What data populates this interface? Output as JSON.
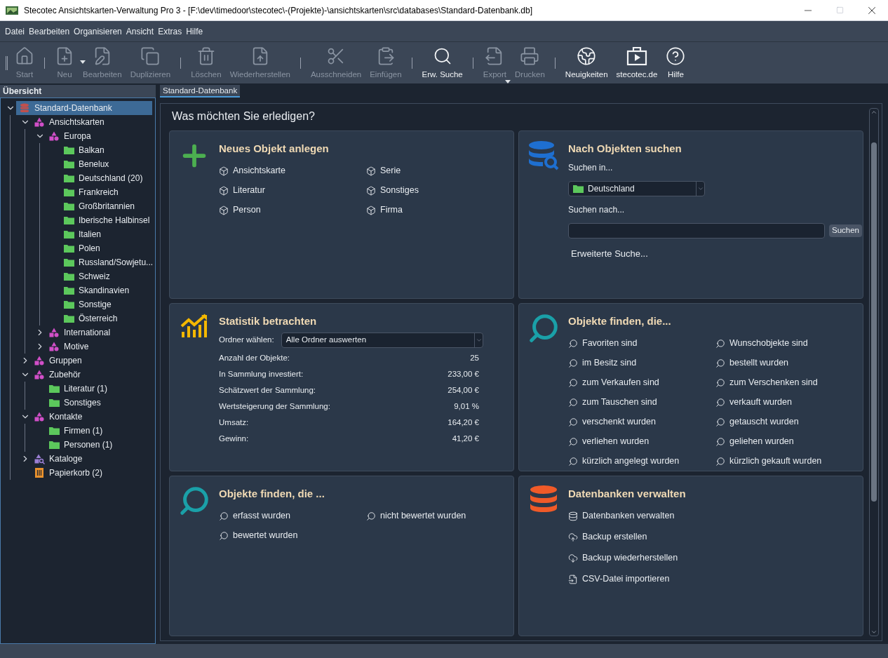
{
  "window": {
    "title": "Stecotec Ansichtskarten-Verwaltung Pro 3 - [F:\\dev\\timedoor\\stecotec\\-(Projekte)-\\ansichtskarten\\src\\databases\\Standard-Datenbank.db]"
  },
  "menu": [
    "Datei",
    "Bearbeiten",
    "Organisieren",
    "Ansicht",
    "Extras",
    "Hilfe"
  ],
  "toolbar": [
    [
      {
        "label": "Start",
        "disabled": true,
        "dropdown": false
      }
    ],
    [
      {
        "label": "Neu",
        "disabled": true,
        "dropdown": true
      },
      {
        "label": "Bearbeiten",
        "disabled": true,
        "dropdown": false
      },
      {
        "label": "Duplizieren",
        "disabled": true,
        "dropdown": false
      }
    ],
    [
      {
        "label": "Löschen",
        "disabled": true,
        "dropdown": false
      },
      {
        "label": "Wiederherstellen",
        "disabled": true,
        "dropdown": false
      }
    ],
    [
      {
        "label": "Ausschneiden",
        "disabled": true,
        "dropdown": false
      },
      {
        "label": "Einfügen",
        "disabled": true,
        "dropdown": false
      }
    ],
    [
      {
        "label": "Erw. Suche",
        "disabled": false,
        "dropdown": false
      }
    ],
    [
      {
        "label": "Export",
        "disabled": true,
        "dropdown": true
      },
      {
        "label": "Drucken",
        "disabled": true,
        "dropdown": false
      }
    ],
    [
      {
        "label": "Neuigkeiten",
        "disabled": false,
        "dropdown": false
      },
      {
        "label": "stecotec.de",
        "disabled": false,
        "dropdown": false
      },
      {
        "label": "Hilfe",
        "disabled": false,
        "dropdown": false
      }
    ]
  ],
  "sidebar": {
    "title": "Übersicht",
    "tree": [
      {
        "kind": "database",
        "label": "Standard-Datenbank",
        "selected": true,
        "expanded": true,
        "children": [
          {
            "kind": "category",
            "label": "Ansichtskarten",
            "selected": false,
            "expanded": true,
            "children": [
              {
                "kind": "category",
                "label": "Europa",
                "selected": false,
                "expanded": true,
                "children": [
                  {
                    "kind": "folder",
                    "label": "Balkan",
                    "selected": false
                  },
                  {
                    "kind": "folder",
                    "label": "Benelux",
                    "selected": false
                  },
                  {
                    "kind": "folder",
                    "label": "Deutschland (20)",
                    "selected": false
                  },
                  {
                    "kind": "folder",
                    "label": "Frankreich",
                    "selected": false
                  },
                  {
                    "kind": "folder",
                    "label": "Großbritannien",
                    "selected": false
                  },
                  {
                    "kind": "folder",
                    "label": "Iberische Halbinsel",
                    "selected": false
                  },
                  {
                    "kind": "folder",
                    "label": "Italien",
                    "selected": false
                  },
                  {
                    "kind": "folder",
                    "label": "Polen",
                    "selected": false
                  },
                  {
                    "kind": "folder",
                    "label": "Russland/Sowjetu...",
                    "selected": false
                  },
                  {
                    "kind": "folder",
                    "label": "Schweiz",
                    "selected": false
                  },
                  {
                    "kind": "folder",
                    "label": "Skandinavien",
                    "selected": false
                  },
                  {
                    "kind": "folder",
                    "label": "Sonstige",
                    "selected": false
                  },
                  {
                    "kind": "folder",
                    "label": "Österreich",
                    "selected": false
                  }
                ]
              },
              {
                "kind": "category",
                "label": "International",
                "selected": false,
                "expanded": false
              },
              {
                "kind": "category",
                "label": "Motive",
                "selected": false,
                "expanded": false
              }
            ]
          },
          {
            "kind": "category",
            "label": "Gruppen",
            "selected": false,
            "expanded": false
          },
          {
            "kind": "category",
            "label": "Zubehör",
            "selected": false,
            "expanded": true,
            "children": [
              {
                "kind": "folder",
                "label": "Literatur (1)",
                "selected": false
              },
              {
                "kind": "folder",
                "label": "Sonstiges",
                "selected": false
              }
            ]
          },
          {
            "kind": "category",
            "label": "Kontakte",
            "selected": false,
            "expanded": true,
            "children": [
              {
                "kind": "folder",
                "label": "Firmen (1)",
                "selected": false
              },
              {
                "kind": "folder",
                "label": "Personen (1)",
                "selected": false
              }
            ]
          },
          {
            "kind": "catalog",
            "label": "Kataloge",
            "selected": false,
            "expanded": false
          },
          {
            "kind": "trash",
            "label": "Papierkorb (2)",
            "selected": false
          }
        ]
      }
    ]
  },
  "tab": {
    "label": "Standard-Datenbank",
    "selected": true
  },
  "heading": "Was möchten Sie erledigen?",
  "cards": [
    {
      "kind": "grid",
      "title": "Neues Objekt anlegen",
      "links": [
        "Ansichtskarte",
        "Serie",
        "Literatur",
        "Sonstiges",
        "Person",
        "Firma"
      ]
    },
    {
      "kind": "search",
      "title": "Nach Objekten suchen",
      "scope_label": "Suchen in...",
      "scope": "Deutschland",
      "query_label": "Suchen nach...",
      "button": "Suchen",
      "link": "Erweiterte Suche..."
    },
    {
      "kind": "stats",
      "title": "Statistik betrachten",
      "folder_label": "Ordner wählen:",
      "folder": "Alle Ordner auswerten",
      "rows": [
        {
          "label": "Anzahl der Objekte:",
          "value": "25"
        },
        {
          "label": "In Sammlung investiert:",
          "value": "233,00 €"
        },
        {
          "label": "Schätzwert der Sammlung:",
          "value": "254,00 €"
        },
        {
          "label": "Wertsteigerung der Sammlung:",
          "value": "9,01 %"
        },
        {
          "label": "Umsatz:",
          "value": "164,20 €"
        },
        {
          "label": "Gewinn:",
          "value": "41,20 €"
        }
      ]
    },
    {
      "kind": "grid",
      "title": "Objekte finden, die...",
      "links": [
        "Favoriten sind",
        "Wunschobjekte sind",
        "im Besitz sind",
        "bestellt wurden",
        "zum Verkaufen sind",
        "zum Verschenken sind",
        "zum Tauschen sind",
        "verkauft wurden",
        "verschenkt wurden",
        "getauscht wurden",
        "verliehen wurden",
        "geliehen wurden",
        "kürzlich angelegt wurden",
        "kürzlich gekauft wurden"
      ]
    },
    {
      "kind": "grid",
      "title": "Objekte finden, die ...",
      "links": [
        "erfasst wurden",
        "nicht bewertet wurden",
        "bewertet wurden"
      ]
    },
    {
      "kind": "list",
      "title": "Datenbanken verwalten",
      "links": [
        "Datenbanken verwalten",
        "Backup erstellen",
        "Backup wiederherstellen",
        "CSV-Datei importieren"
      ]
    }
  ]
}
